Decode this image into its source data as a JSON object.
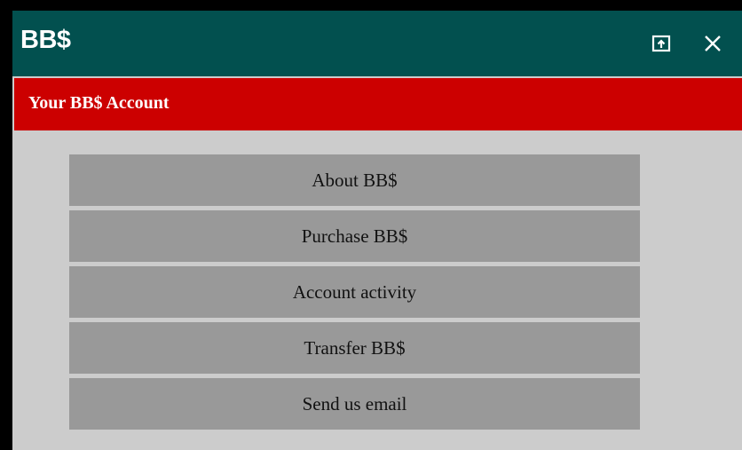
{
  "window": {
    "title": "BB$",
    "popout_icon": "popout-icon",
    "close_icon": "close-icon"
  },
  "header": {
    "title": "Your BB$ Account"
  },
  "menu": {
    "items": [
      {
        "label": "About BB$"
      },
      {
        "label": "Purchase BB$"
      },
      {
        "label": "Account activity"
      },
      {
        "label": "Transfer BB$"
      },
      {
        "label": "Send us email"
      }
    ]
  },
  "colors": {
    "titlebar": "#02504f",
    "header": "#cc0000",
    "background": "#cccccc",
    "button": "#999999"
  }
}
